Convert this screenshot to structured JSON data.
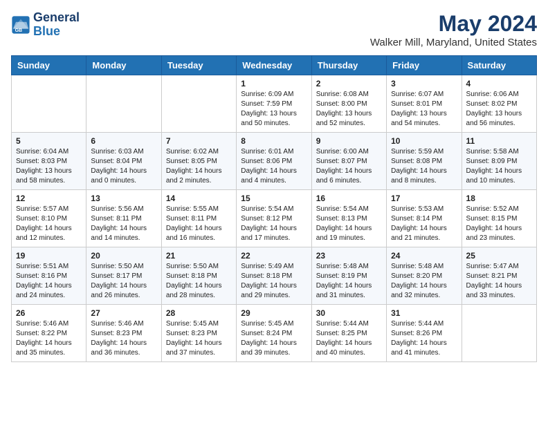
{
  "header": {
    "logo_line1": "General",
    "logo_line2": "Blue",
    "month": "May 2024",
    "location": "Walker Mill, Maryland, United States"
  },
  "weekdays": [
    "Sunday",
    "Monday",
    "Tuesday",
    "Wednesday",
    "Thursday",
    "Friday",
    "Saturday"
  ],
  "weeks": [
    [
      {
        "day": "",
        "text": ""
      },
      {
        "day": "",
        "text": ""
      },
      {
        "day": "",
        "text": ""
      },
      {
        "day": "1",
        "text": "Sunrise: 6:09 AM\nSunset: 7:59 PM\nDaylight: 13 hours\nand 50 minutes."
      },
      {
        "day": "2",
        "text": "Sunrise: 6:08 AM\nSunset: 8:00 PM\nDaylight: 13 hours\nand 52 minutes."
      },
      {
        "day": "3",
        "text": "Sunrise: 6:07 AM\nSunset: 8:01 PM\nDaylight: 13 hours\nand 54 minutes."
      },
      {
        "day": "4",
        "text": "Sunrise: 6:06 AM\nSunset: 8:02 PM\nDaylight: 13 hours\nand 56 minutes."
      }
    ],
    [
      {
        "day": "5",
        "text": "Sunrise: 6:04 AM\nSunset: 8:03 PM\nDaylight: 13 hours\nand 58 minutes."
      },
      {
        "day": "6",
        "text": "Sunrise: 6:03 AM\nSunset: 8:04 PM\nDaylight: 14 hours\nand 0 minutes."
      },
      {
        "day": "7",
        "text": "Sunrise: 6:02 AM\nSunset: 8:05 PM\nDaylight: 14 hours\nand 2 minutes."
      },
      {
        "day": "8",
        "text": "Sunrise: 6:01 AM\nSunset: 8:06 PM\nDaylight: 14 hours\nand 4 minutes."
      },
      {
        "day": "9",
        "text": "Sunrise: 6:00 AM\nSunset: 8:07 PM\nDaylight: 14 hours\nand 6 minutes."
      },
      {
        "day": "10",
        "text": "Sunrise: 5:59 AM\nSunset: 8:08 PM\nDaylight: 14 hours\nand 8 minutes."
      },
      {
        "day": "11",
        "text": "Sunrise: 5:58 AM\nSunset: 8:09 PM\nDaylight: 14 hours\nand 10 minutes."
      }
    ],
    [
      {
        "day": "12",
        "text": "Sunrise: 5:57 AM\nSunset: 8:10 PM\nDaylight: 14 hours\nand 12 minutes."
      },
      {
        "day": "13",
        "text": "Sunrise: 5:56 AM\nSunset: 8:11 PM\nDaylight: 14 hours\nand 14 minutes."
      },
      {
        "day": "14",
        "text": "Sunrise: 5:55 AM\nSunset: 8:11 PM\nDaylight: 14 hours\nand 16 minutes."
      },
      {
        "day": "15",
        "text": "Sunrise: 5:54 AM\nSunset: 8:12 PM\nDaylight: 14 hours\nand 17 minutes."
      },
      {
        "day": "16",
        "text": "Sunrise: 5:54 AM\nSunset: 8:13 PM\nDaylight: 14 hours\nand 19 minutes."
      },
      {
        "day": "17",
        "text": "Sunrise: 5:53 AM\nSunset: 8:14 PM\nDaylight: 14 hours\nand 21 minutes."
      },
      {
        "day": "18",
        "text": "Sunrise: 5:52 AM\nSunset: 8:15 PM\nDaylight: 14 hours\nand 23 minutes."
      }
    ],
    [
      {
        "day": "19",
        "text": "Sunrise: 5:51 AM\nSunset: 8:16 PM\nDaylight: 14 hours\nand 24 minutes."
      },
      {
        "day": "20",
        "text": "Sunrise: 5:50 AM\nSunset: 8:17 PM\nDaylight: 14 hours\nand 26 minutes."
      },
      {
        "day": "21",
        "text": "Sunrise: 5:50 AM\nSunset: 8:18 PM\nDaylight: 14 hours\nand 28 minutes."
      },
      {
        "day": "22",
        "text": "Sunrise: 5:49 AM\nSunset: 8:18 PM\nDaylight: 14 hours\nand 29 minutes."
      },
      {
        "day": "23",
        "text": "Sunrise: 5:48 AM\nSunset: 8:19 PM\nDaylight: 14 hours\nand 31 minutes."
      },
      {
        "day": "24",
        "text": "Sunrise: 5:48 AM\nSunset: 8:20 PM\nDaylight: 14 hours\nand 32 minutes."
      },
      {
        "day": "25",
        "text": "Sunrise: 5:47 AM\nSunset: 8:21 PM\nDaylight: 14 hours\nand 33 minutes."
      }
    ],
    [
      {
        "day": "26",
        "text": "Sunrise: 5:46 AM\nSunset: 8:22 PM\nDaylight: 14 hours\nand 35 minutes."
      },
      {
        "day": "27",
        "text": "Sunrise: 5:46 AM\nSunset: 8:23 PM\nDaylight: 14 hours\nand 36 minutes."
      },
      {
        "day": "28",
        "text": "Sunrise: 5:45 AM\nSunset: 8:23 PM\nDaylight: 14 hours\nand 37 minutes."
      },
      {
        "day": "29",
        "text": "Sunrise: 5:45 AM\nSunset: 8:24 PM\nDaylight: 14 hours\nand 39 minutes."
      },
      {
        "day": "30",
        "text": "Sunrise: 5:44 AM\nSunset: 8:25 PM\nDaylight: 14 hours\nand 40 minutes."
      },
      {
        "day": "31",
        "text": "Sunrise: 5:44 AM\nSunset: 8:26 PM\nDaylight: 14 hours\nand 41 minutes."
      },
      {
        "day": "",
        "text": ""
      }
    ]
  ]
}
